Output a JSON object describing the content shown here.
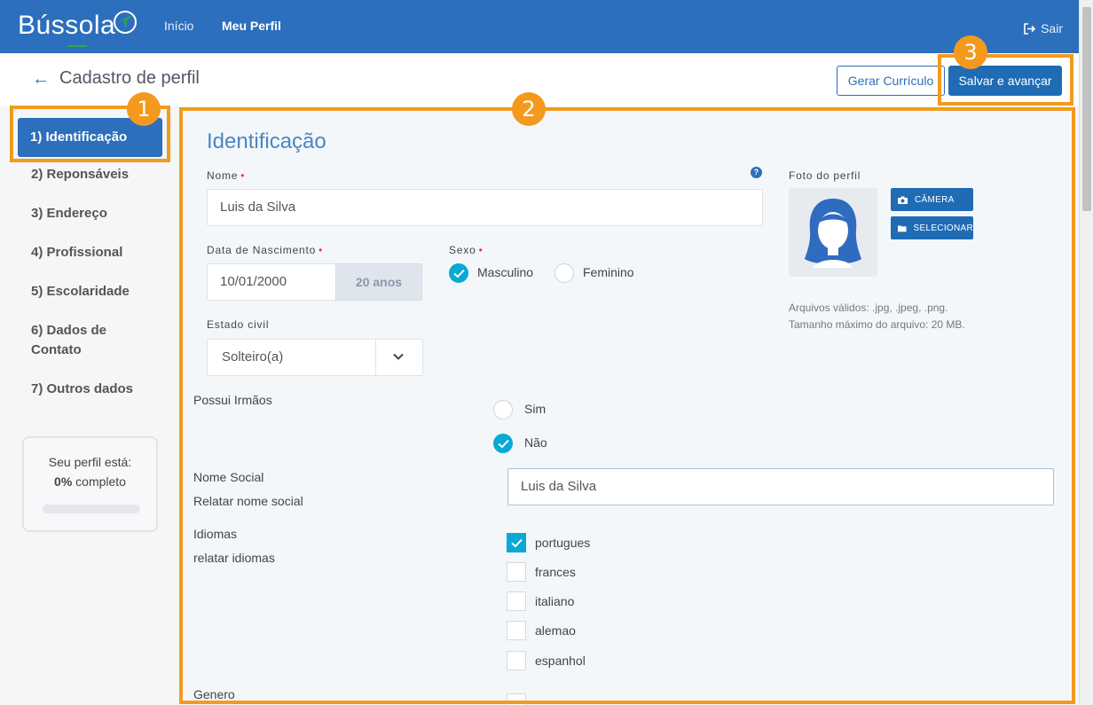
{
  "topbar": {
    "brand": "Bússola",
    "nav": {
      "inicio": "Início",
      "perfil": "Meu Perfil"
    },
    "logout": "Sair"
  },
  "header": {
    "title": "Cadastro de perfil",
    "btn_curriculo": "Gerar Currículo",
    "btn_salvar": "Salvar e avançar"
  },
  "sidebar": {
    "items": [
      {
        "label": "1) Identificação"
      },
      {
        "label": "2) Reponsáveis"
      },
      {
        "label": "3) Endereço"
      },
      {
        "label": "4) Profissional"
      },
      {
        "label": "5) Escolaridade"
      },
      {
        "label": "6) Dados de"
      },
      {
        "label": "Contato"
      },
      {
        "label": "7) Outros dados"
      }
    ],
    "progress": {
      "line1": "Seu perfil está:",
      "percent": "0%",
      "suffix": " completo",
      "value": 0
    }
  },
  "form": {
    "section_title": "Identificação",
    "nome": {
      "label": "Nome",
      "value": "Luis da Silva",
      "help": "?"
    },
    "nascimento": {
      "label": "Data de Nascimento",
      "value": "10/01/2000",
      "age": "20 anos"
    },
    "sexo": {
      "label": "Sexo",
      "options": [
        "Masculino",
        "Feminino"
      ],
      "selected": "Masculino"
    },
    "estado_civil": {
      "label": "Estado civil",
      "value": "Solteiro(a)"
    },
    "irmaos": {
      "label": "Possui Irmãos",
      "options": [
        "Sim",
        "Não"
      ],
      "selected": "Não"
    },
    "nome_social": {
      "label": "Nome Social",
      "sublabel": "Relatar nome social",
      "value": "Luis da Silva"
    },
    "idiomas": {
      "label": "Idiomas",
      "sublabel": "relatar idiomas",
      "options": [
        "portugues",
        "frances",
        "italiano",
        "alemao",
        "espanhol"
      ],
      "checked": [
        "portugues"
      ]
    },
    "genero": {
      "label": "Genero"
    }
  },
  "photo": {
    "label": "Foto do perfil",
    "btn_camera": "CÂMERA",
    "btn_select": "SELECIONAR",
    "hint1": "Arquivos válidos: .jpg, .jpeg, .png.",
    "hint2": "Tamanho máximo do arquivo: 20 MB."
  },
  "annotations": [
    "1",
    "2",
    "3"
  ],
  "colors": {
    "primary": "#2c6fbc",
    "accent": "#0aa8d4",
    "annotation": "#f39a1e"
  }
}
